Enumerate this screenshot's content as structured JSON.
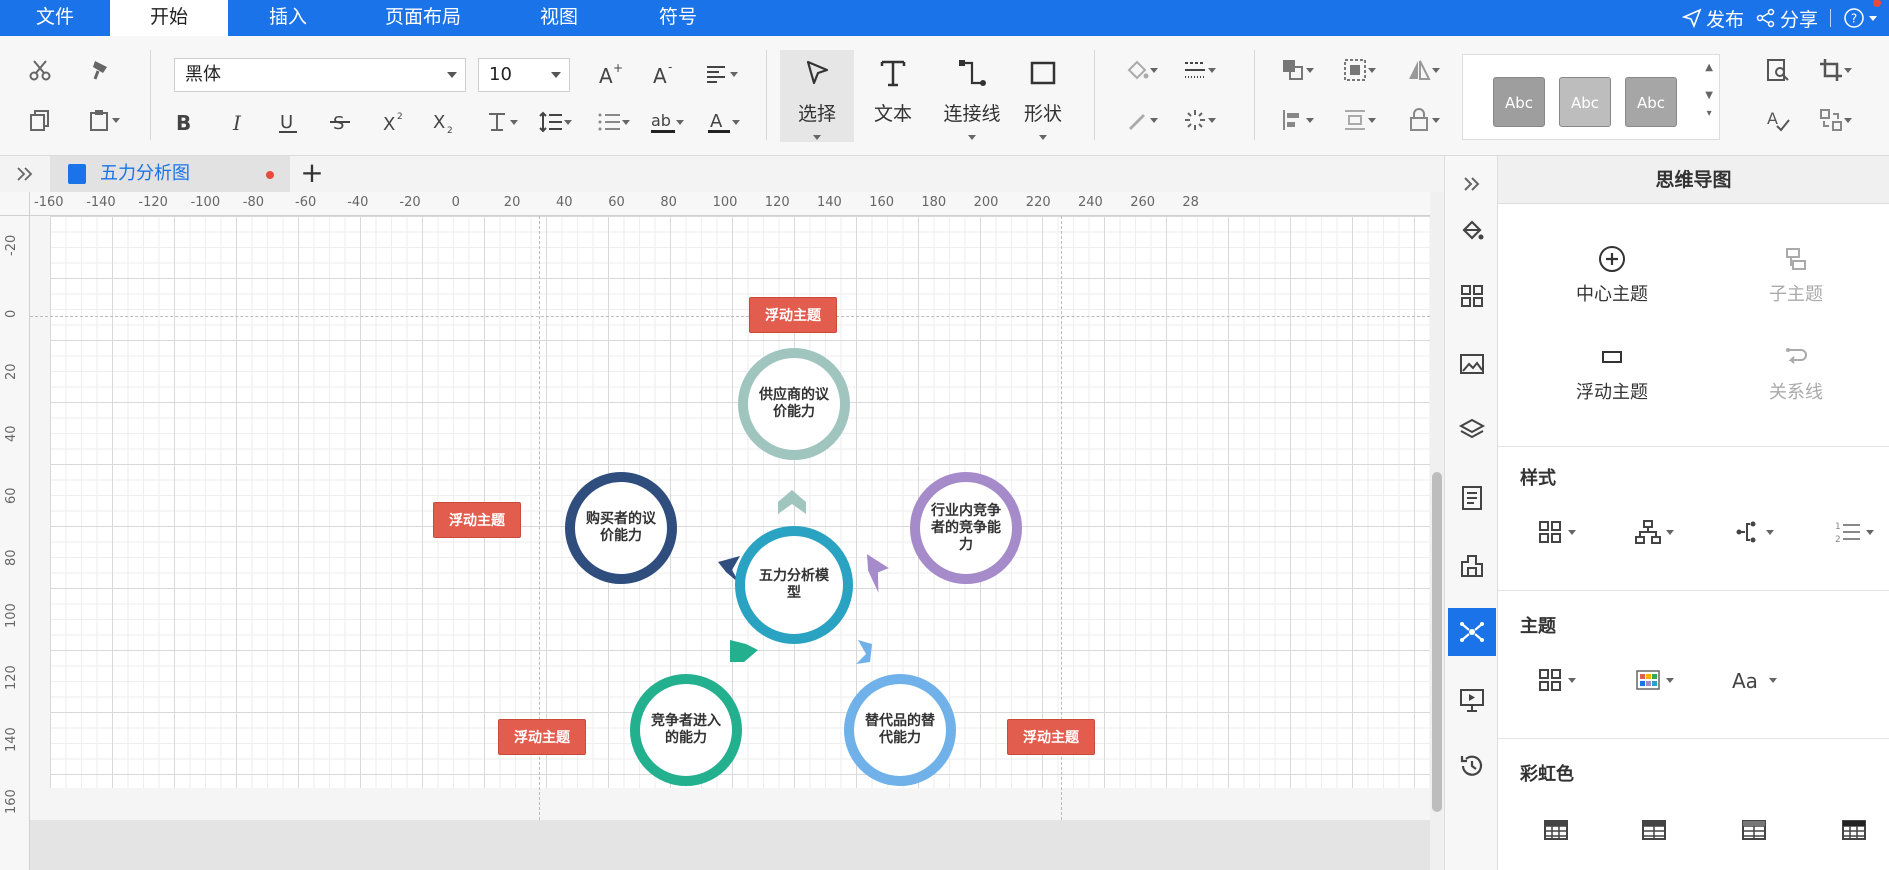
{
  "menu": {
    "items": [
      "文件",
      "开始",
      "插入",
      "页面布局",
      "视图",
      "符号"
    ],
    "active_index": 1,
    "publish": "发布",
    "share": "分享",
    "help": "?"
  },
  "ribbon": {
    "font_name": "黑体",
    "font_size": "10",
    "select_label": "选择",
    "text_label": "文本",
    "connector_label": "连接线",
    "shape_label": "形状",
    "styles": [
      {
        "label": "Abc",
        "color": "#9e9e9e"
      },
      {
        "label": "Abc",
        "color": "#bdbdbd"
      },
      {
        "label": "Abc",
        "color": "#a6a6a6"
      }
    ]
  },
  "document": {
    "tab_title": "五力分析图",
    "add_tab": "+"
  },
  "rulers": {
    "horizontal": [
      "-160",
      "-140",
      "-120",
      "-100",
      "-80",
      "-60",
      "-40",
      "-20",
      "0",
      "20",
      "40",
      "60",
      "80",
      "100",
      "120",
      "140",
      "160",
      "180",
      "200",
      "220",
      "240",
      "260",
      "28"
    ],
    "vertical": [
      "-20",
      "0",
      "20",
      "40",
      "60",
      "80",
      "100",
      "120",
      "140",
      "160"
    ]
  },
  "diagram": {
    "center": {
      "label": "五力分析模型",
      "color": "#2aa3c2"
    },
    "forces": [
      {
        "label": "供应商的议价能力",
        "color": "#9fc5be"
      },
      {
        "label": "购买者的议价能力",
        "color": "#2f4e7e"
      },
      {
        "label": "行业内竞争者的竞争能力",
        "color": "#a58bc9"
      },
      {
        "label": "竞争者进入的能力",
        "color": "#23b08f"
      },
      {
        "label": "替代品的替代能力",
        "color": "#6fb1e8"
      }
    ],
    "floating_topics": [
      "浮动主题",
      "浮动主题",
      "浮动主题",
      "浮动主题"
    ],
    "floating_color": "#e35d4f"
  },
  "panel": {
    "title": "思维导图",
    "tools": {
      "center_topic": "中心主题",
      "sub_topic": "子主题",
      "floating_topic": "浮动主题",
      "relation_line": "关系线"
    },
    "sections": {
      "style": "样式",
      "theme": "主题",
      "rainbow": "彩虹色"
    }
  },
  "colors": {
    "accent": "#1a73e8",
    "floating": "#e35d4f"
  }
}
